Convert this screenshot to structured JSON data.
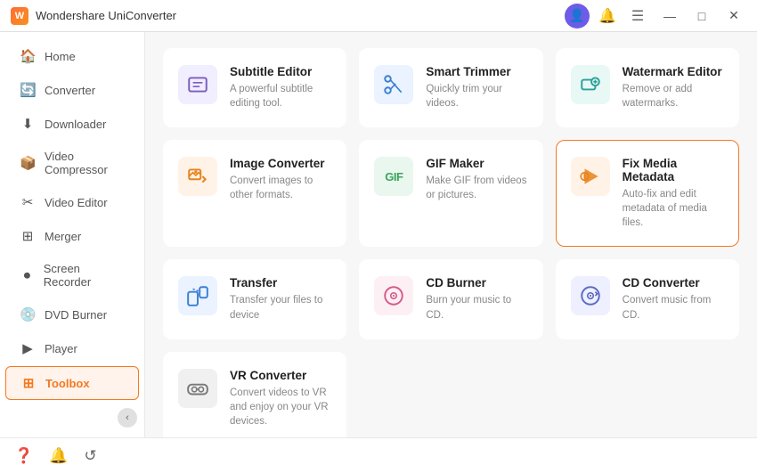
{
  "app": {
    "title": "Wondershare UniConverter",
    "icon_text": "W"
  },
  "titlebar": {
    "minimize": "—",
    "maximize": "□",
    "close": "✕"
  },
  "sidebar": {
    "items": [
      {
        "id": "home",
        "label": "Home",
        "icon": "🏠"
      },
      {
        "id": "converter",
        "label": "Converter",
        "icon": "🔄"
      },
      {
        "id": "downloader",
        "label": "Downloader",
        "icon": "⬇"
      },
      {
        "id": "video-compressor",
        "label": "Video Compressor",
        "icon": "📦"
      },
      {
        "id": "video-editor",
        "label": "Video Editor",
        "icon": "✂"
      },
      {
        "id": "merger",
        "label": "Merger",
        "icon": "⊞"
      },
      {
        "id": "screen-recorder",
        "label": "Screen Recorder",
        "icon": "⏺"
      },
      {
        "id": "dvd-burner",
        "label": "DVD Burner",
        "icon": "💿"
      },
      {
        "id": "player",
        "label": "Player",
        "icon": "▶"
      },
      {
        "id": "toolbox",
        "label": "Toolbox",
        "icon": "⊞",
        "active": true
      }
    ],
    "collapse_icon": "‹"
  },
  "tools": [
    {
      "id": "subtitle-editor",
      "name": "Subtitle Editor",
      "desc": "A powerful subtitle editing tool.",
      "icon_char": "📝",
      "icon_class": "icon-purple"
    },
    {
      "id": "smart-trimmer",
      "name": "Smart Trimmer",
      "desc": "Quickly trim your videos.",
      "icon_char": "✂",
      "icon_class": "icon-blue"
    },
    {
      "id": "watermark-editor",
      "name": "Watermark Editor",
      "desc": "Remove or add watermarks.",
      "icon_char": "🔲",
      "icon_class": "icon-teal"
    },
    {
      "id": "image-converter",
      "name": "Image Converter",
      "desc": "Convert images to other formats.",
      "icon_char": "🖼",
      "icon_class": "icon-orange"
    },
    {
      "id": "gif-maker",
      "name": "GIF Maker",
      "desc": "Make GIF from videos or pictures.",
      "icon_char": "GIF",
      "icon_class": "icon-green"
    },
    {
      "id": "fix-media-metadata",
      "name": "Fix Media Metadata",
      "desc": "Auto-fix and edit metadata of media files.",
      "icon_char": "▶",
      "icon_class": "icon-orange",
      "selected": true
    },
    {
      "id": "transfer",
      "name": "Transfer",
      "desc": "Transfer your files to device",
      "icon_char": "⇄",
      "icon_class": "icon-blue"
    },
    {
      "id": "cd-burner",
      "name": "CD Burner",
      "desc": "Burn your music to CD.",
      "icon_char": "💿",
      "icon_class": "icon-pink"
    },
    {
      "id": "cd-converter",
      "name": "CD Converter",
      "desc": "Convert music from CD.",
      "icon_char": "💿",
      "icon_class": "icon-indigo"
    },
    {
      "id": "vr-converter",
      "name": "VR Converter",
      "desc": "Convert videos to VR and enjoy on your VR devices.",
      "icon_char": "🥽",
      "icon_class": "icon-gray"
    }
  ],
  "bottombar": {
    "icons": [
      "❓",
      "🔔",
      "↺"
    ]
  }
}
